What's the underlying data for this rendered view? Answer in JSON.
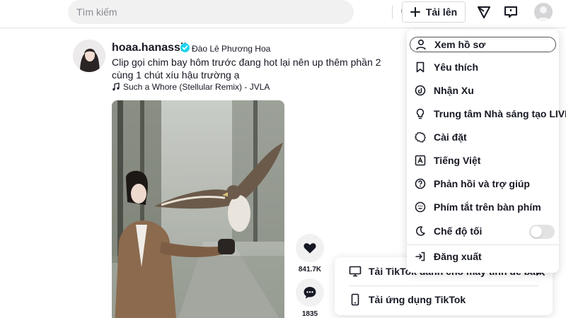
{
  "header": {
    "search": {
      "placeholder": "Tìm kiếm",
      "value": "",
      "icon": "search-icon"
    },
    "upload_label": "Tải lên",
    "icons": [
      "plus-icon",
      "send-filter-icon",
      "message-icon",
      "profile-avatar"
    ]
  },
  "post": {
    "username": "hoaa.hanassii",
    "nickname": "Đào Lê Phương Hoa",
    "caption": "Clip gọi chim bay hôm trước đang hot lại nên up thêm phần 2 cùng 1 chút xíu hậu trường ạ",
    "music": "Such a Whore (Stellular Remix) - JVLA",
    "likes": "841.7K",
    "comments": "1835"
  },
  "menu": {
    "items": [
      {
        "label": "Xem hồ sơ",
        "icon": "user-icon"
      },
      {
        "label": "Yêu thích",
        "icon": "bookmark-icon"
      },
      {
        "label": "Nhận Xu",
        "icon": "coin-icon"
      },
      {
        "label": "Trung tâm Nhà sáng tạo LIVE",
        "icon": "bulb-icon"
      },
      {
        "label": "Cài đặt",
        "icon": "gear-icon"
      },
      {
        "label": "Tiếng Việt",
        "icon": "language-icon"
      },
      {
        "label": "Phản hồi và trợ giúp",
        "icon": "help-icon"
      },
      {
        "label": "Phím tắt trên bàn phím",
        "icon": "keyboard-icon"
      },
      {
        "label": "Chế độ tối",
        "icon": "moon-icon"
      },
      {
        "label": "Đăng xuất",
        "icon": "logout-icon"
      }
    ],
    "dark_mode_on": false
  },
  "download_popup": {
    "desktop_label": "Tải TikTok dành cho máy tính để bàn",
    "app_label": "Tải ứng dụng TikTok"
  },
  "colors": {
    "accent": "#fe2c55",
    "verified": "#20d5ec",
    "text": "#161823"
  }
}
